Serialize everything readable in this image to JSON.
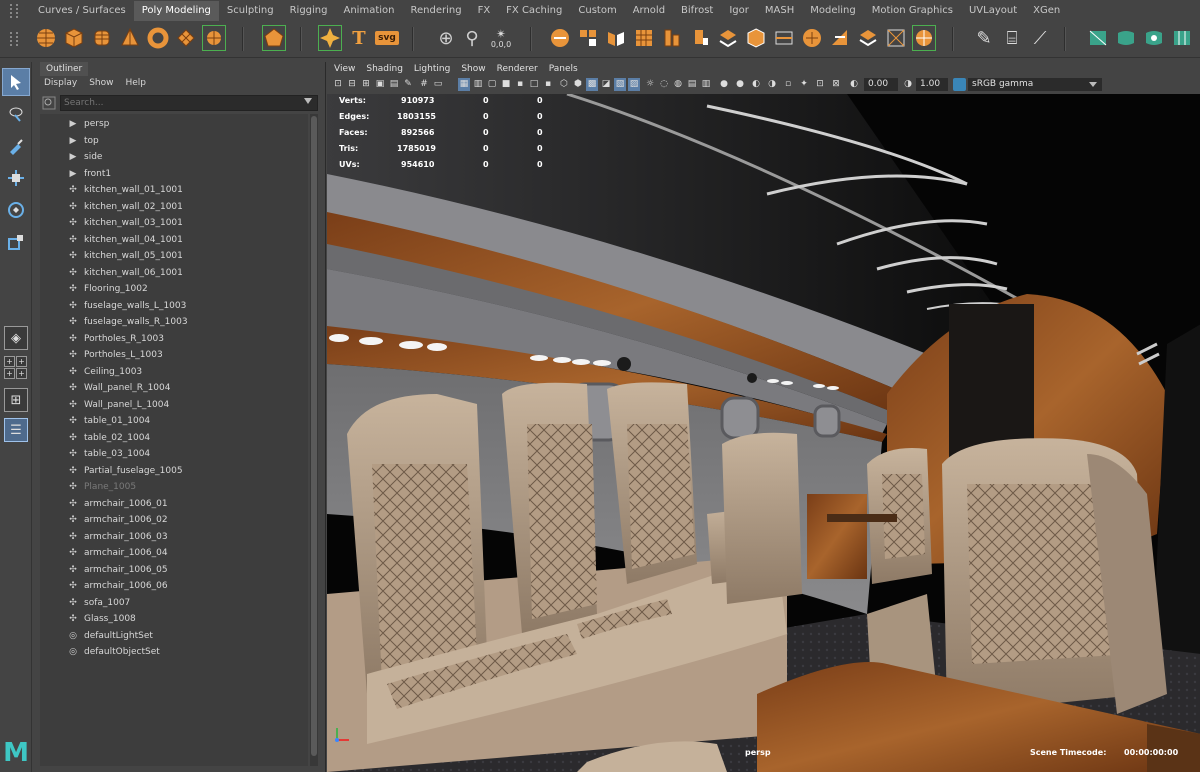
{
  "shelf": {
    "tabs": [
      "Curves / Surfaces",
      "Poly Modeling",
      "Sculpting",
      "Rigging",
      "Animation",
      "Rendering",
      "FX",
      "FX Caching",
      "Custom",
      "Arnold",
      "Bifrost",
      "Igor",
      "MASH",
      "Modeling",
      "Motion Graphics",
      "UVLayout",
      "XGen"
    ],
    "active_tab": "Poly Modeling",
    "icon_text_tool": "T",
    "icon_svg": "svg",
    "icon_readout": "0,0,0"
  },
  "toolbox": {
    "tools": [
      "select-tool-icon",
      "lasso-tool-icon",
      "paint-select-icon",
      "move-tool-icon",
      "rotate-tool-icon",
      "scale-tool-icon"
    ],
    "logo": "M"
  },
  "outliner": {
    "tab_label": "Outliner",
    "menu": [
      "Display",
      "Show",
      "Help"
    ],
    "search_placeholder": "Search...",
    "items": [
      {
        "label": "persp",
        "icon": "camera-icon",
        "dim": false
      },
      {
        "label": "top",
        "icon": "camera-icon",
        "dim": false
      },
      {
        "label": "side",
        "icon": "camera-icon",
        "dim": false
      },
      {
        "label": "front1",
        "icon": "camera-icon",
        "dim": false
      },
      {
        "label": "kitchen_wall_01_1001",
        "icon": "mesh-icon",
        "dim": false
      },
      {
        "label": "kitchen_wall_02_1001",
        "icon": "mesh-icon",
        "dim": false
      },
      {
        "label": "kitchen_wall_03_1001",
        "icon": "mesh-icon",
        "dim": false
      },
      {
        "label": "kitchen_wall_04_1001",
        "icon": "mesh-icon",
        "dim": false
      },
      {
        "label": "kitchen_wall_05_1001",
        "icon": "mesh-icon",
        "dim": false
      },
      {
        "label": "kitchen_wall_06_1001",
        "icon": "mesh-icon",
        "dim": false
      },
      {
        "label": "Flooring_1002",
        "icon": "mesh-icon",
        "dim": false
      },
      {
        "label": "fuselage_walls_L_1003",
        "icon": "mesh-icon",
        "dim": false
      },
      {
        "label": "fuselage_walls_R_1003",
        "icon": "mesh-icon",
        "dim": false
      },
      {
        "label": "Portholes_R_1003",
        "icon": "mesh-icon",
        "dim": false
      },
      {
        "label": "Portholes_L_1003",
        "icon": "mesh-icon",
        "dim": false
      },
      {
        "label": "Ceiling_1003",
        "icon": "mesh-icon",
        "dim": false
      },
      {
        "label": "Wall_panel_R_1004",
        "icon": "mesh-icon",
        "dim": false
      },
      {
        "label": "Wall_panel_L_1004",
        "icon": "mesh-icon",
        "dim": false
      },
      {
        "label": "table_01_1004",
        "icon": "mesh-icon",
        "dim": false
      },
      {
        "label": "table_02_1004",
        "icon": "mesh-icon",
        "dim": false
      },
      {
        "label": "table_03_1004",
        "icon": "mesh-icon",
        "dim": false
      },
      {
        "label": "Partial_fuselage_1005",
        "icon": "mesh-icon",
        "dim": false
      },
      {
        "label": "Plane_1005",
        "icon": "mesh-icon",
        "dim": true
      },
      {
        "label": "armchair_1006_01",
        "icon": "mesh-icon",
        "dim": false
      },
      {
        "label": "armchair_1006_02",
        "icon": "mesh-icon",
        "dim": false
      },
      {
        "label": "armchair_1006_03",
        "icon": "mesh-icon",
        "dim": false
      },
      {
        "label": "armchair_1006_04",
        "icon": "mesh-icon",
        "dim": false
      },
      {
        "label": "armchair_1006_05",
        "icon": "mesh-icon",
        "dim": false
      },
      {
        "label": "armchair_1006_06",
        "icon": "mesh-icon",
        "dim": false
      },
      {
        "label": "sofa_1007",
        "icon": "mesh-icon",
        "dim": false
      },
      {
        "label": "Glass_1008",
        "icon": "mesh-icon",
        "dim": false
      },
      {
        "label": "defaultLightSet",
        "icon": "set-icon",
        "dim": false
      },
      {
        "label": "defaultObjectSet",
        "icon": "set-icon",
        "dim": false
      }
    ]
  },
  "viewport": {
    "menu": [
      "View",
      "Shading",
      "Lighting",
      "Show",
      "Renderer",
      "Panels"
    ],
    "exposure": "0.00",
    "gamma": "1.00",
    "color_space": "sRGB gamma",
    "hud": [
      {
        "label": "Verts:",
        "v1": "910973",
        "v2": "0",
        "v3": "0"
      },
      {
        "label": "Edges:",
        "v1": "1803155",
        "v2": "0",
        "v3": "0"
      },
      {
        "label": "Faces:",
        "v1": "892566",
        "v2": "0",
        "v3": "0"
      },
      {
        "label": "Tris:",
        "v1": "1785019",
        "v2": "0",
        "v3": "0"
      },
      {
        "label": "UVs:",
        "v1": "954610",
        "v2": "0",
        "v3": "0"
      }
    ],
    "camera": "persp",
    "timecode_label": "Scene Timecode:",
    "timecode_value": "00:00:00:00"
  },
  "colors": {
    "active_blue": "#5b7ea6",
    "maya_logo": "#3ec7c4",
    "leather": "#b49d86",
    "wood": "#8a4a20"
  }
}
